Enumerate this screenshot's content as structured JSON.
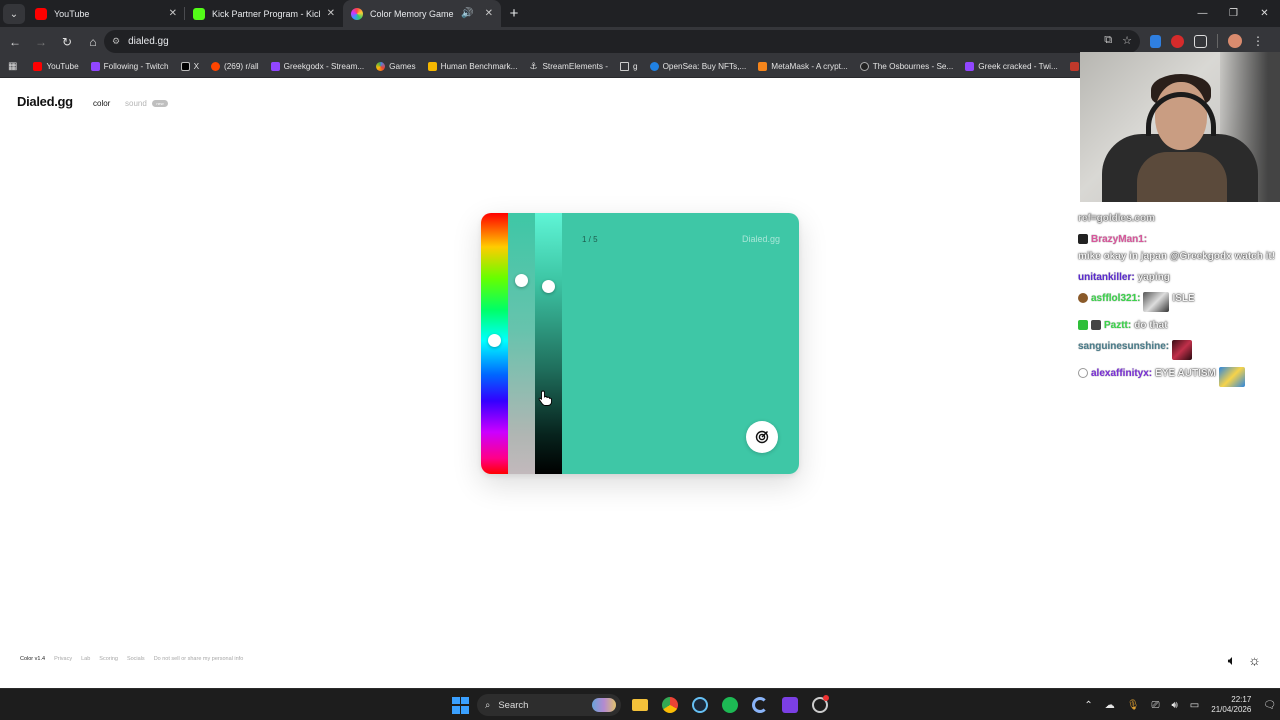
{
  "browser": {
    "tabs": [
      {
        "title": "YouTube",
        "close": "✕",
        "favicon_color": "#ff0000",
        "active": false
      },
      {
        "title": "Kick Partner Program - Kick Da",
        "close": "✕",
        "favicon_color": "#53fc18",
        "active": false
      },
      {
        "title": "Color Memory Game — Ho",
        "close": "✕",
        "favicon_color": "#e84fb0",
        "active": true
      }
    ],
    "url": "dialed.gg",
    "bookmarks": [
      {
        "label": "YouTube",
        "color": "#ff0000"
      },
      {
        "label": "Following - Twitch",
        "color": "#9146ff"
      },
      {
        "label": "X",
        "color": "#dddddd"
      },
      {
        "label": "(269) r/all",
        "color": "#ff4500"
      },
      {
        "label": "Greekgodx - Stream...",
        "color": "#9146ff"
      },
      {
        "label": "Games",
        "color": "#4285f4"
      },
      {
        "label": "Human Benchmark...",
        "color": "#f5b700"
      },
      {
        "label": "StreamElements -",
        "color": "#dddddd"
      },
      {
        "label": "g",
        "color": "#e3e3e3"
      },
      {
        "label": "OpenSea: Buy NFTs,...",
        "color": "#2081e2"
      },
      {
        "label": "MetaMask - A crypt...",
        "color": "#f6851b"
      },
      {
        "label": "The Osbournes - Se...",
        "color": "#cccccc"
      },
      {
        "label": "Greek cracked - Twi...",
        "color": "#9146ff"
      },
      {
        "label": "D",
        "color": "#c0392b"
      }
    ]
  },
  "site": {
    "brand": "Dialed.gg",
    "nav_color": "color",
    "nav_sound": "sound",
    "nav_sound_badge": "new"
  },
  "game": {
    "round": "1 / 5",
    "watermark": "Dialed.gg",
    "preview_color": "#3ec7a6",
    "hue_knob": 0.49,
    "saturation_knob": 0.26,
    "lightness_knob": 0.28
  },
  "footer": {
    "version": "Color v1.4",
    "links": [
      "Privacy",
      "Lab",
      "Scoring",
      "Socials",
      "Do not sell or share my personal info"
    ]
  },
  "chat": [
    {
      "user": "",
      "message": "ref=goldies.com",
      "user_color": "#9c9c9c"
    },
    {
      "user": "BrazyMan1:",
      "message": "mike okay in japan @Greekgodx watch it!",
      "user_color": "#d9569c"
    },
    {
      "user": "unitankiller:",
      "message": "yaping",
      "user_color": "#5a2ad0"
    },
    {
      "user": "asfflol321:",
      "message": "ISLE",
      "user_color": "#3bd44b"
    },
    {
      "user": "Paztt:",
      "message": "do that",
      "user_color": "#3bd44b"
    },
    {
      "user": "sanguinesunshine:",
      "message": "",
      "user_color": "#4a7d8b"
    },
    {
      "user": "alexaffinityx:",
      "message": "EYE AUTISM",
      "user_color": "#7a2fd6"
    }
  ],
  "taskbar": {
    "search": "Search",
    "time": "22:17",
    "date": "21/04/2026"
  }
}
